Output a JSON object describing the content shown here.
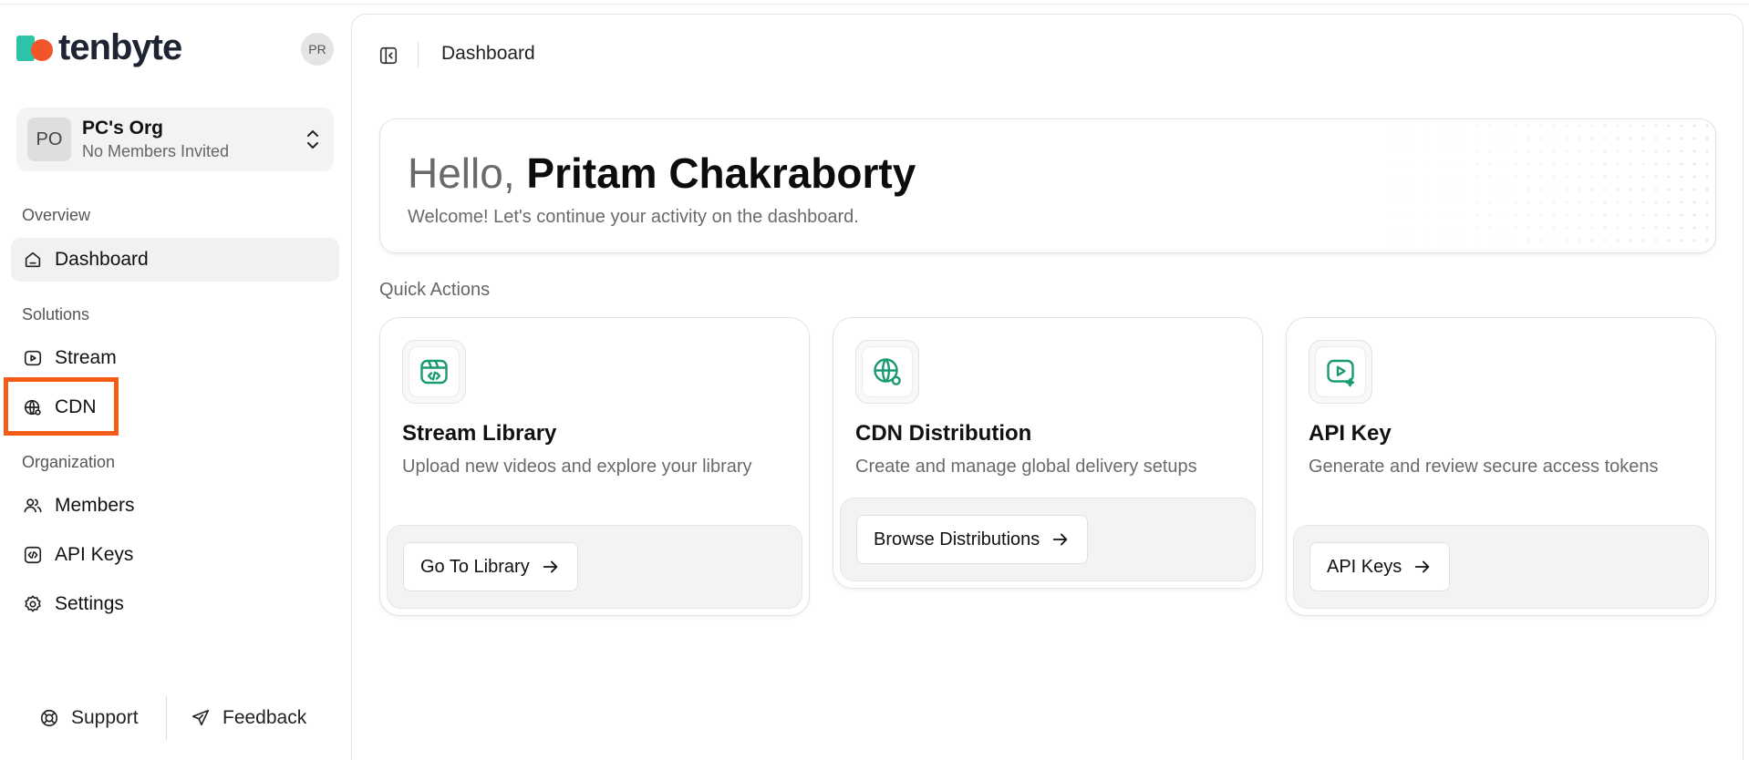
{
  "brand": {
    "name": "tenbyte",
    "teal": "#2cc3a6",
    "orange": "#f0562a"
  },
  "user": {
    "initials": "PR"
  },
  "org": {
    "initials": "PO",
    "name": "PC's Org",
    "subtitle": "No Members Invited"
  },
  "sidebar": {
    "sections": {
      "overview": "Overview",
      "solutions": "Solutions",
      "organization": "Organization"
    },
    "items": {
      "dashboard": "Dashboard",
      "stream": "Stream",
      "cdn": "CDN",
      "members": "Members",
      "api_keys": "API Keys",
      "settings": "Settings"
    },
    "footer": {
      "support": "Support",
      "feedback": "Feedback"
    },
    "highlight_color": "#f25c16"
  },
  "header": {
    "breadcrumb": "Dashboard"
  },
  "hello": {
    "greeting": "Hello,",
    "name": "Pritam Chakraborty",
    "subtitle": "Welcome! Let's continue your activity on the dashboard."
  },
  "quick_actions": {
    "label": "Quick Actions",
    "accent": "#1a9a73",
    "cards": [
      {
        "icon": "stream-library-icon",
        "title": "Stream Library",
        "description": "Upload new videos and explore your library",
        "button": "Go To Library"
      },
      {
        "icon": "cdn-globe-icon",
        "title": "CDN Distribution",
        "description": "Create and manage global delivery setups",
        "button": "Browse Distributions"
      },
      {
        "icon": "api-key-video-icon",
        "title": "API Key",
        "description": "Generate and review secure access tokens",
        "button": "API Keys"
      }
    ]
  }
}
